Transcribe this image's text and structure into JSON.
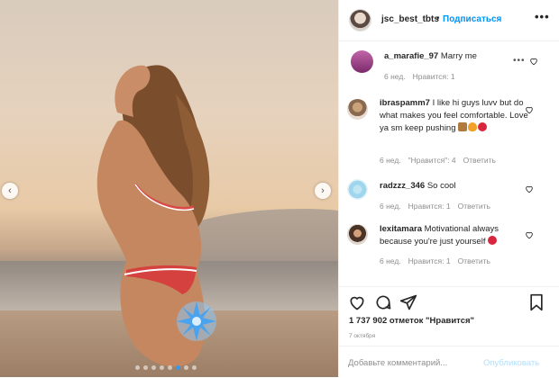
{
  "photo": {
    "prev_arrow": "‹",
    "next_arrow": "›",
    "dots_count": 8,
    "active_dot": 5
  },
  "header": {
    "username": "jsc_best_tbts",
    "separator": "•",
    "follow_label": "Подписаться",
    "more_label": "•••"
  },
  "comments": [
    {
      "username": "a_marafie_97",
      "text": "Marry me",
      "time": "6 нед.",
      "likes": "Нравится: 1",
      "reply": ""
    },
    {
      "username": "ibraspamm7",
      "text": "I like hi guys luvv but do what makes you feel comfortable. Love ya sm keep pushing",
      "time": "6 нед.",
      "likes": "\"Нравится\": 4",
      "reply": "Ответить"
    },
    {
      "username": "radzzz_346",
      "text": "So cool",
      "time": "6 нед.",
      "likes": "Нравится: 1",
      "reply": "Ответить"
    },
    {
      "username": "lexitamara",
      "text": "Motivational always because you're just yourself",
      "time": "6 нед.",
      "likes": "Нравится: 1",
      "reply": "Ответить"
    }
  ],
  "likes_text": "1 737 902 отметок \"Нравится\"",
  "date_text": "7 октября",
  "add_comment": {
    "placeholder": "Добавьте комментарий...",
    "publish_label": "Опубликовать"
  },
  "colors": {
    "accent": "#0095f6",
    "publish_disabled": "#b2dffc",
    "heart_red": "#ed4956",
    "muted": "#8e8e8e"
  }
}
